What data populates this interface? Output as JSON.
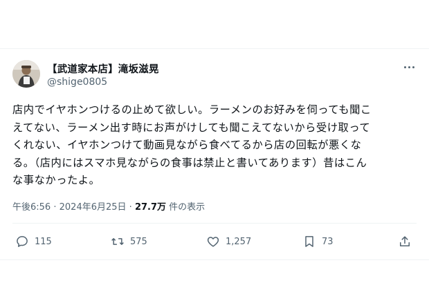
{
  "tweet": {
    "author_name": "【武道家本店】滝坂滋晃",
    "author_handle": "@shige0805",
    "body": "店内でイヤホンつけるの止めて欲しい。ラーメンのお好みを伺っても聞こ\nえてない、ラーメン出す時にお声がけしても聞こえてないから受け取って\nくれない、イヤホンつけて動画見ながら食べてるから店の回転が悪くな\nる。（店内にはスマホ見ながらの食事は禁止と書いてあります）昔はこん\nな事なかったよ。",
    "time": "午後6:56",
    "separator": "·",
    "date": "2024年6月25日",
    "views": "27.7万",
    "views_label": "件の表示"
  },
  "actions": {
    "reply_count": "115",
    "retweet_count": "575",
    "like_count": "1,257",
    "bookmark_count": "73"
  },
  "icons": {
    "more": "more-dots-icon",
    "reply": "reply-icon",
    "retweet": "retweet-icon",
    "like": "heart-icon",
    "bookmark": "bookmark-icon",
    "share": "share-icon"
  },
  "colors": {
    "text": "#0f1419",
    "secondary": "#536471",
    "border": "#eff3f4"
  }
}
